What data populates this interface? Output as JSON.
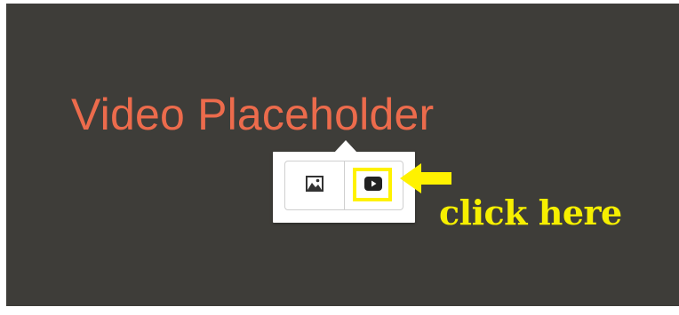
{
  "canvas": {
    "placeholder_text": "Video Placeholder",
    "background_color": "#3e3d39",
    "text_color": "#ec6b4c"
  },
  "popover": {
    "buttons": [
      {
        "name": "image",
        "icon": "image-icon"
      },
      {
        "name": "video",
        "icon": "video-play-icon",
        "highlighted": true
      }
    ]
  },
  "annotation": {
    "label": "click here",
    "color": "#f6ef00",
    "arrow_icon": "arrow-left-icon"
  }
}
